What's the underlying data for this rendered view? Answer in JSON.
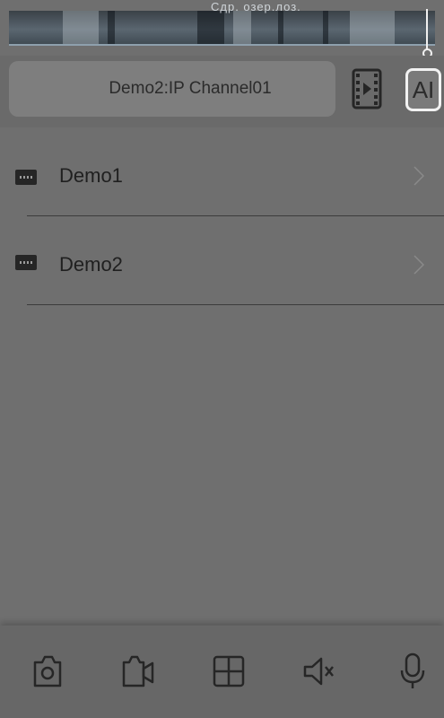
{
  "video": {
    "caption": "Сдр. озер.лоз."
  },
  "channel": {
    "name": "Demo2:IP Channel01",
    "ai_label": "AI"
  },
  "devices": [
    {
      "label": "Demo1",
      "icon": "dvr-device-icon"
    },
    {
      "label": "Demo2",
      "icon": "dvr-device-icon"
    }
  ],
  "toolbar": {
    "items": [
      "snapshot-camera-icon",
      "record-video-icon",
      "split-screen-grid-icon",
      "mute-audio-icon",
      "microphone-icon"
    ]
  },
  "colors": {
    "overlay": "#6f6f6f",
    "icon_dark": "#262626",
    "highlight": "#f2f2f2"
  }
}
